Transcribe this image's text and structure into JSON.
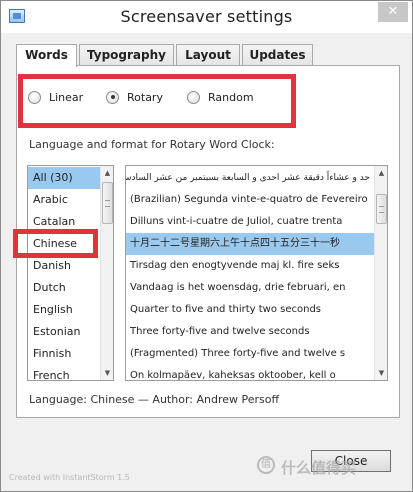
{
  "window": {
    "title": "Screensaver settings",
    "close_glyph": "✕"
  },
  "tabs": [
    {
      "label": "Words",
      "active": true
    },
    {
      "label": "Typography",
      "active": false
    },
    {
      "label": "Layout",
      "active": false
    },
    {
      "label": "Updates",
      "active": false
    }
  ],
  "mode": {
    "options": [
      {
        "label": "Linear",
        "checked": false
      },
      {
        "label": "Rotary",
        "checked": true
      },
      {
        "label": "Random",
        "checked": false
      }
    ]
  },
  "section_label": "Language and format for Rotary Word Clock:",
  "languages": [
    {
      "label": "All (30)",
      "selected": true
    },
    {
      "label": "Arabic",
      "selected": false
    },
    {
      "label": "Catalan",
      "selected": false
    },
    {
      "label": "Chinese",
      "selected": false
    },
    {
      "label": "Danish",
      "selected": false
    },
    {
      "label": "Dutch",
      "selected": false
    },
    {
      "label": "English",
      "selected": false
    },
    {
      "label": "Estonian",
      "selected": false
    },
    {
      "label": "Finnish",
      "selected": false
    },
    {
      "label": "French",
      "selected": false
    }
  ],
  "formats": [
    {
      "label": "حد و عشاءاً دقيقة عشر احدى و السابعة بسبتمبر من عشر السادس الخميس",
      "selected": false,
      "rtl": true
    },
    {
      "label": "(Brazilian) Segunda vinte-e-quatro de Fevereiro",
      "selected": false,
      "rtl": false
    },
    {
      "label": "Dilluns vint-i-cuatre de Juliol, cuatre trenta",
      "selected": false,
      "rtl": false
    },
    {
      "label": "十月二十二号星期六上午十点四十五分三十一秒",
      "selected": true,
      "rtl": false
    },
    {
      "label": "Tirsdag den enogtyvende maj kl. fire seks",
      "selected": false,
      "rtl": false
    },
    {
      "label": "Vandaag is het woensdag, drie februari, en",
      "selected": false,
      "rtl": false
    },
    {
      "label": "Quarter to five and thirty two seconds",
      "selected": false,
      "rtl": false
    },
    {
      "label": "Three forty-five and twelve seconds",
      "selected": false,
      "rtl": false
    },
    {
      "label": "(Fragmented) Three forty-five and twelve s",
      "selected": false,
      "rtl": false
    },
    {
      "label": "On kolmapäev, kaheksas oktoober, kell o",
      "selected": false,
      "rtl": false
    }
  ],
  "info": "Language: Chinese — Author: Andrew Persoff",
  "footer": {
    "credit": "Created with InstantStorm 1.5",
    "close_label": "Close"
  },
  "watermark": {
    "text": "什么值得买",
    "icon": "值"
  },
  "colors": {
    "selection": "#99c9ef",
    "highlight_box": "#e2323d"
  },
  "icons": {
    "app": "window-icon",
    "scroll_up": "▲",
    "scroll_down": "▼"
  }
}
